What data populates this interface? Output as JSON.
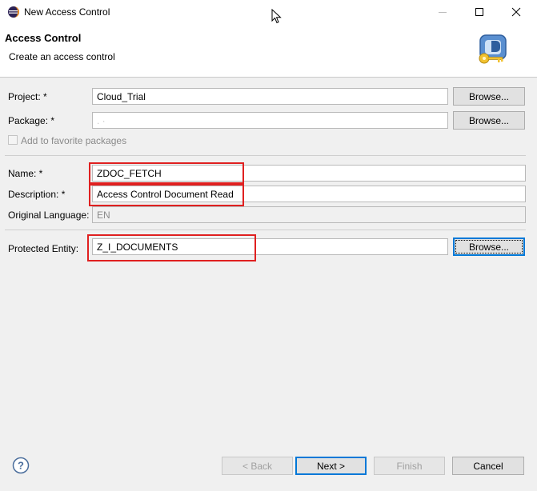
{
  "window": {
    "title": "New Access Control"
  },
  "header": {
    "title": "Access Control",
    "message": "Create an access control"
  },
  "form": {
    "project": {
      "label": "Project: *",
      "value": "Cloud_Trial",
      "browse": "Browse..."
    },
    "package": {
      "label": "Package: *",
      "value": ". ·",
      "browse": "Browse..."
    },
    "favorite": {
      "label": "Add to favorite packages",
      "checked": false
    },
    "name": {
      "label": "Name: *",
      "value": "ZDOC_FETCH"
    },
    "description": {
      "label": "Description: *",
      "value": "Access Control  Document Read"
    },
    "language": {
      "label": "Original Language:",
      "value": "EN"
    },
    "entity": {
      "label": "Protected Entity:",
      "value": "Z_I_DOCUMENTS",
      "browse": "Browse..."
    }
  },
  "footer": {
    "back": "< Back",
    "next": "Next >",
    "finish": "Finish",
    "cancel": "Cancel"
  },
  "icons": {
    "app": "eclipse-icon",
    "banner": "access-control-key-icon",
    "help": "help-icon"
  },
  "colors": {
    "highlight": "#e02020",
    "focus": "#0078d7"
  }
}
